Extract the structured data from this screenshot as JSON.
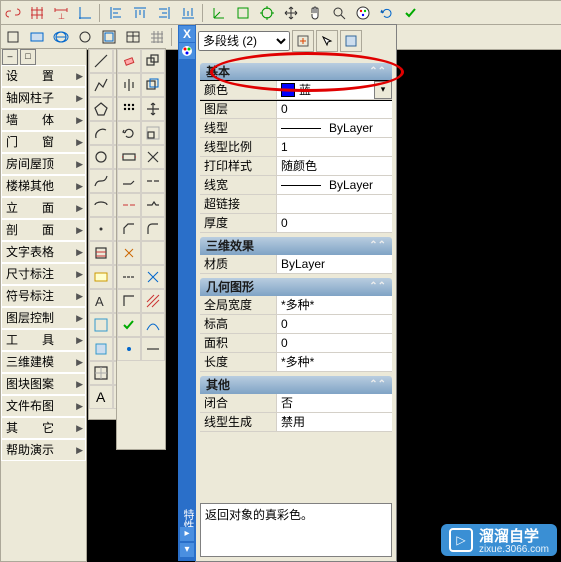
{
  "top_toolbar_1_icons": [
    "link-icon",
    "grid-red-icon",
    "dimension-icon",
    "axis-blue-icon",
    "sep",
    "align-left-icon",
    "align-top-icon",
    "align-right-icon",
    "align-bottom-icon",
    "sep",
    "coord-sys-icon",
    "plane-icon",
    "snap-icon",
    "move-icon",
    "pan-icon",
    "zoom-icon",
    "palette-icon",
    "redraw-icon",
    "check-green-icon"
  ],
  "top_toolbar_2_icons": [
    "box-icon",
    "view-icon",
    "globe-icon",
    "circle-icon",
    "viewport-icon",
    "table-icon",
    "grid-icon",
    "sep",
    "brush-icon",
    "eye-icon",
    "dashed-box-icon",
    "layers-icon",
    "color-wheel-icon",
    "wall-icon",
    "point-icon"
  ],
  "left_panel": {
    "items": [
      {
        "label": "设　　置"
      },
      {
        "label": "轴网柱子"
      },
      {
        "label": "墙　　体"
      },
      {
        "label": "门　　窗"
      },
      {
        "label": "房间屋顶"
      },
      {
        "label": "楼梯其他"
      },
      {
        "label": "立　　面"
      },
      {
        "label": "剖　　面"
      },
      {
        "label": "文字表格"
      },
      {
        "label": "尺寸标注"
      },
      {
        "label": "符号标注"
      },
      {
        "label": "图层控制"
      },
      {
        "label": "工　　具"
      },
      {
        "label": "三维建模"
      },
      {
        "label": "图块图案"
      },
      {
        "label": "文件布图"
      },
      {
        "label": "其　　它"
      },
      {
        "label": "帮助演示"
      }
    ]
  },
  "palette1_icons": [
    "line",
    "ray",
    "pline",
    "xline",
    "polygon",
    "rect",
    "arc",
    "arc3",
    "circle",
    "donut",
    "spline",
    "ellipse",
    "earc",
    "cloud",
    "point",
    "block",
    "hatch",
    "grad",
    "region",
    "table",
    "mtext",
    "",
    "tool1",
    "tool2",
    "tool3",
    "tool4",
    "tool5",
    "tool6",
    "A",
    ""
  ],
  "palette2_icons": [
    "erase",
    "copy",
    "mirror",
    "offset",
    "array",
    "move",
    "rotate",
    "scale",
    "stretch",
    "trim",
    "extend",
    "break",
    "break2",
    "join",
    "chamfer",
    "fillet",
    "explode",
    "",
    "dash",
    "cross",
    "corner",
    "hatch2",
    "check",
    "curve",
    "dot",
    "line2"
  ],
  "props": {
    "close": "X",
    "selector_label": "多段线 (2)",
    "groups": [
      {
        "header": "基本",
        "rows": [
          {
            "k": "颜色",
            "v": "蓝",
            "swatch": "#0000ff",
            "dd": true,
            "sel": true
          },
          {
            "k": "图层",
            "v": "0"
          },
          {
            "k": "线型",
            "v": "ByLayer",
            "line": true
          },
          {
            "k": "线型比例",
            "v": "1"
          },
          {
            "k": "打印样式",
            "v": "随颜色"
          },
          {
            "k": "线宽",
            "v": "ByLayer",
            "line": true
          },
          {
            "k": "超链接",
            "v": ""
          },
          {
            "k": "厚度",
            "v": "0"
          }
        ]
      },
      {
        "header": "三维效果",
        "rows": [
          {
            "k": "材质",
            "v": "ByLayer"
          }
        ]
      },
      {
        "header": "几何图形",
        "rows": [
          {
            "k": "全局宽度",
            "v": "*多种*"
          },
          {
            "k": "标高",
            "v": "0"
          },
          {
            "k": "面积",
            "v": "0"
          },
          {
            "k": "长度",
            "v": "*多种*"
          }
        ]
      },
      {
        "header": "其他",
        "rows": [
          {
            "k": "闭合",
            "v": "否"
          },
          {
            "k": "线型生成",
            "v": "禁用"
          }
        ]
      }
    ],
    "side_label": "特性",
    "help_text": "返回对象的真彩色。"
  },
  "watermark": {
    "zh": "溜溜自学",
    "en": "zixue.3066.com",
    "play": "▷"
  }
}
